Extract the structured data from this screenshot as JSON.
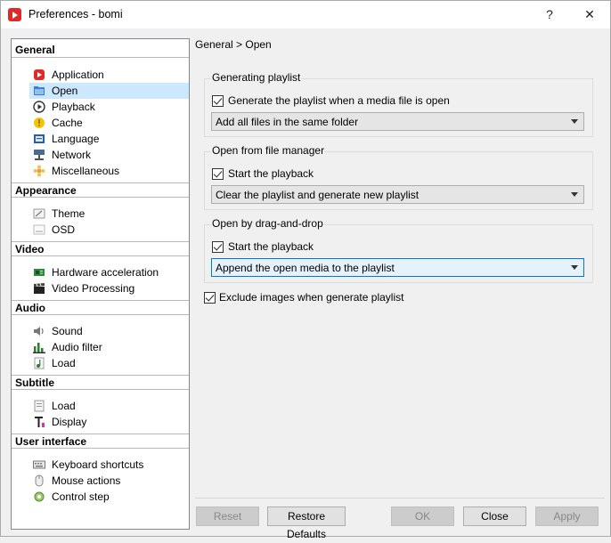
{
  "window": {
    "title": "Preferences - bomi",
    "help_glyph": "?",
    "close_glyph": "✕"
  },
  "breadcrumb": "General > Open",
  "tree": {
    "general": {
      "label": "General",
      "items": [
        "Application",
        "Open",
        "Playback",
        "Cache",
        "Language",
        "Network",
        "Miscellaneous"
      ]
    },
    "appearance": {
      "label": "Appearance",
      "items": [
        "Theme",
        "OSD"
      ]
    },
    "video": {
      "label": "Video",
      "items": [
        "Hardware acceleration",
        "Video Processing"
      ]
    },
    "audio": {
      "label": "Audio",
      "items": [
        "Sound",
        "Audio filter",
        "Load"
      ]
    },
    "subtitle": {
      "label": "Subtitle",
      "items": [
        "Load",
        "Display"
      ]
    },
    "ui": {
      "label": "User interface",
      "items": [
        "Keyboard shortcuts",
        "Mouse actions",
        "Control step"
      ]
    },
    "selected": "Open"
  },
  "groups": {
    "generating": {
      "title": "Generating playlist",
      "check_label": "Generate the playlist when a media file is open",
      "checked": true,
      "combo_value": "Add all files in the same folder"
    },
    "file_manager": {
      "title": "Open from file manager",
      "check_label": "Start the playback",
      "checked": true,
      "combo_value": "Clear the playlist and generate new playlist"
    },
    "drag_drop": {
      "title": "Open by drag-and-drop",
      "check_label": "Start the playback",
      "checked": true,
      "combo_value": "Append the open media to the playlist"
    }
  },
  "exclude_images": {
    "label": "Exclude images when generate playlist",
    "checked": true
  },
  "buttons": {
    "reset": "Reset",
    "restore": "Restore Defaults",
    "ok": "OK",
    "close": "Close",
    "apply": "Apply"
  },
  "colors": {
    "selection": "#cce8ff",
    "brand_red": "#e02a2a",
    "focus_blue": "#0078d7"
  }
}
